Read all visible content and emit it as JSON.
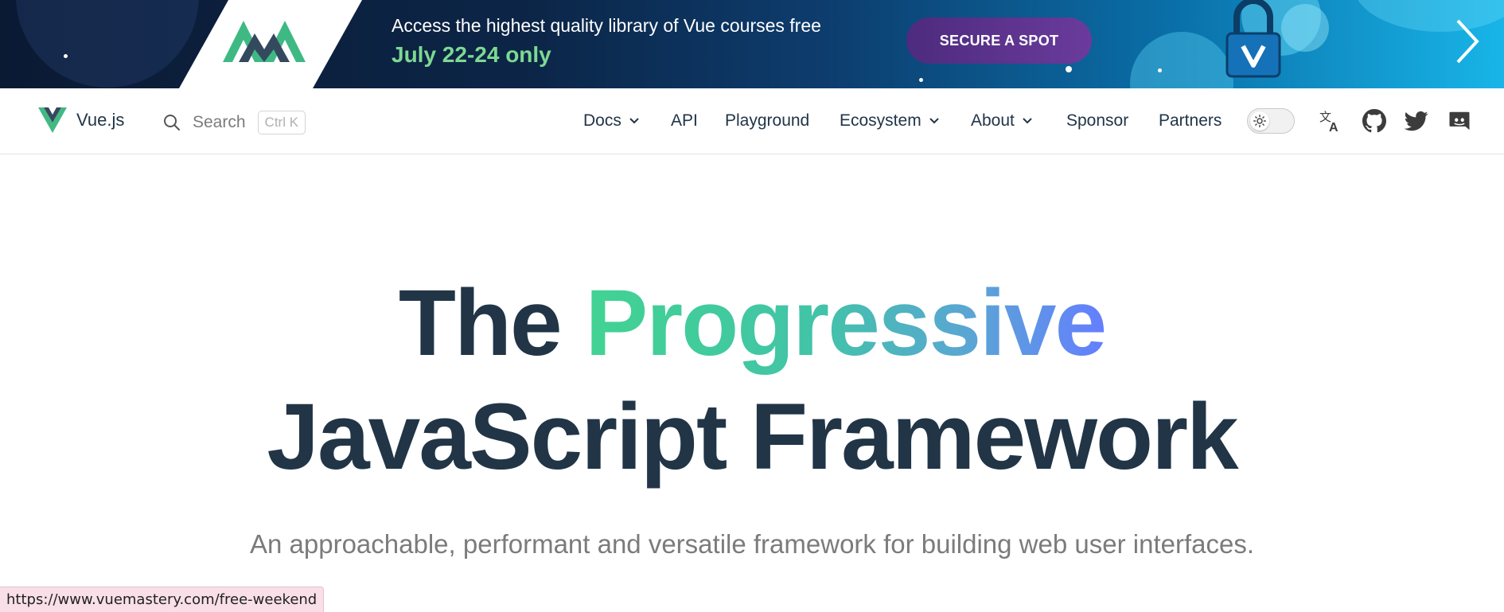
{
  "banner": {
    "line1": "Access the highest quality library of Vue courses free",
    "line2": "July 22-24 only",
    "cta_label": "SECURE A SPOT",
    "colors": {
      "accent_green": "#7cd992",
      "button": "#5a3490"
    }
  },
  "nav": {
    "brand": "Vue.js",
    "search_label": "Search",
    "search_shortcut": "Ctrl K",
    "items": {
      "docs": "Docs",
      "api": "API",
      "playground": "Playground",
      "ecosystem": "Ecosystem",
      "about": "About",
      "sponsor": "Sponsor",
      "partners": "Partners"
    },
    "icons": [
      "translate-icon",
      "github-icon",
      "twitter-icon",
      "discord-icon"
    ]
  },
  "hero": {
    "title_the": "The",
    "title_accent": "Progressive",
    "title_line2": "JavaScript Framework",
    "tagline": "An approachable, performant and versatile framework for building web user interfaces.",
    "colors": {
      "text": "#213547",
      "gradient_start": "#42d392",
      "gradient_end": "#647eff"
    }
  },
  "status_bar": {
    "url": "https://www.vuemastery.com/free-weekend"
  }
}
